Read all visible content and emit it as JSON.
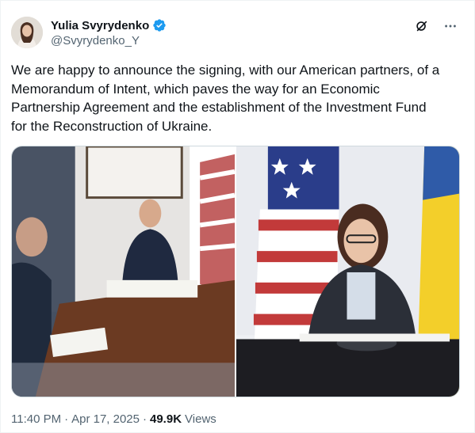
{
  "author": {
    "display_name": "Yulia Svyrydenko",
    "handle": "@Svyrydenko_Y",
    "verified": true,
    "avatar_icon": "profile-photo"
  },
  "tweet": {
    "text": "We are happy to announce the signing, with our American partners, of a\nMemorandum of Intent, which paves the way for an Economic\nPartnership Agreement and the establishment of the Investment Fund\nfor the Reconstruction of Ukraine."
  },
  "media": {
    "photos": [
      {
        "icon": "photo-video-call-signing"
      },
      {
        "icon": "photo-minister-signing"
      }
    ]
  },
  "meta": {
    "time": "11:40 PM",
    "date": "Apr 17, 2025",
    "separator": "·",
    "views_count": "49.9K",
    "views_label": "Views"
  },
  "actions": {
    "grok_icon": "grok-icon",
    "more_icon": "more-icon"
  },
  "colors": {
    "text": "#0f1419",
    "secondary": "#536471",
    "verified": "#1d9bf0",
    "border": "#cfd9de"
  }
}
